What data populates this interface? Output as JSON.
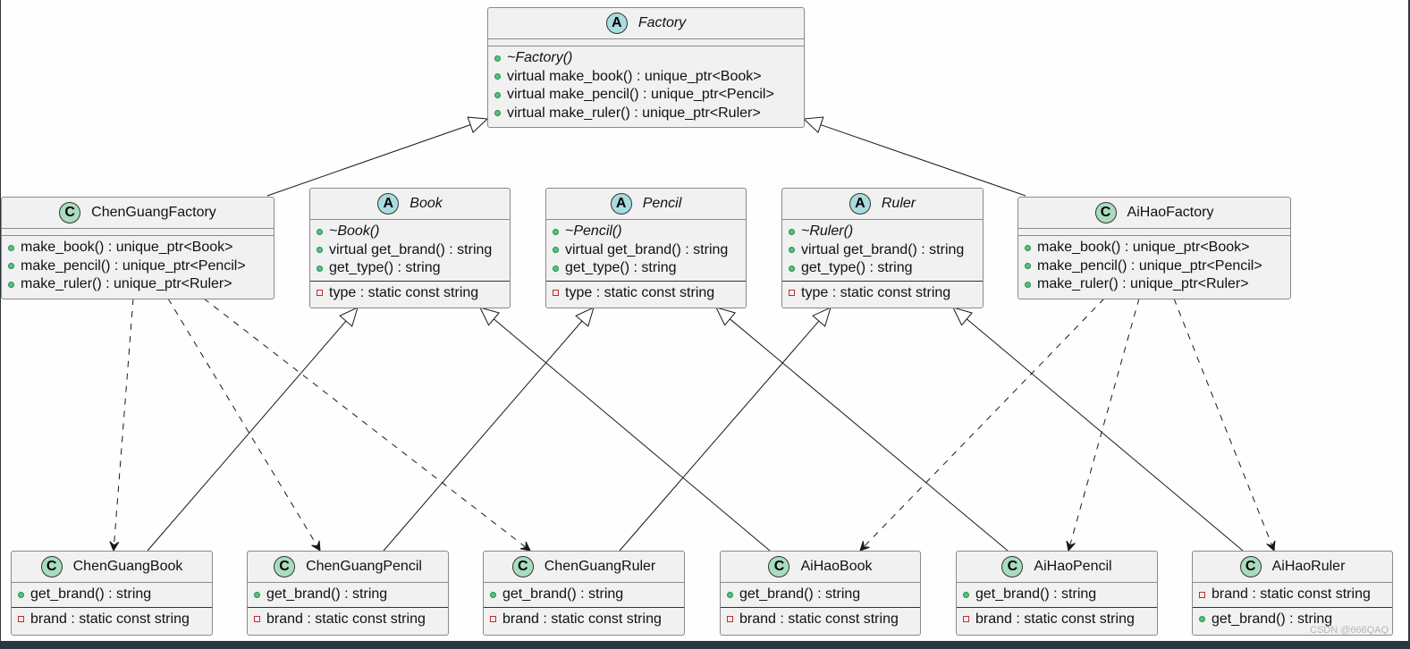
{
  "classes": [
    {
      "id": "Factory",
      "name": "Factory",
      "stereotype": "A",
      "sections": [
        [],
        [
          {
            "vis": "public",
            "text": "~Factory()",
            "italic": true
          },
          {
            "vis": "public",
            "text": "virtual make_book() : unique_ptr<Book>"
          },
          {
            "vis": "public",
            "text": "virtual make_pencil() : unique_ptr<Pencil>"
          },
          {
            "vis": "public",
            "text": "virtual make_ruler() : unique_ptr<Ruler>"
          }
        ]
      ]
    },
    {
      "id": "ChenGuangFactory",
      "name": "ChenGuangFactory",
      "stereotype": "C",
      "sections": [
        [],
        [
          {
            "vis": "public",
            "text": "make_book() : unique_ptr<Book>"
          },
          {
            "vis": "public",
            "text": "make_pencil() : unique_ptr<Pencil>"
          },
          {
            "vis": "public",
            "text": "make_ruler() : unique_ptr<Ruler>"
          }
        ]
      ]
    },
    {
      "id": "Book",
      "name": "Book",
      "stereotype": "A",
      "sections": [
        [
          {
            "vis": "public",
            "text": "~Book()",
            "italic": true
          },
          {
            "vis": "public",
            "text": "virtual get_brand() : string"
          },
          {
            "vis": "public",
            "text": "get_type() : string"
          }
        ],
        [
          {
            "vis": "private",
            "text": "type : static const string"
          }
        ]
      ]
    },
    {
      "id": "Pencil",
      "name": "Pencil",
      "stereotype": "A",
      "sections": [
        [
          {
            "vis": "public",
            "text": "~Pencil()",
            "italic": true
          },
          {
            "vis": "public",
            "text": "virtual get_brand() : string"
          },
          {
            "vis": "public",
            "text": "get_type() : string"
          }
        ],
        [
          {
            "vis": "private",
            "text": "type : static const string"
          }
        ]
      ]
    },
    {
      "id": "Ruler",
      "name": "Ruler",
      "stereotype": "A",
      "sections": [
        [
          {
            "vis": "public",
            "text": "~Ruler()",
            "italic": true
          },
          {
            "vis": "public",
            "text": "virtual get_brand() : string"
          },
          {
            "vis": "public",
            "text": "get_type() : string"
          }
        ],
        [
          {
            "vis": "private",
            "text": "type : static const string"
          }
        ]
      ]
    },
    {
      "id": "AiHaoFactory",
      "name": "AiHaoFactory",
      "stereotype": "C",
      "sections": [
        [],
        [
          {
            "vis": "public",
            "text": "make_book() : unique_ptr<Book>"
          },
          {
            "vis": "public",
            "text": "make_pencil() : unique_ptr<Pencil>"
          },
          {
            "vis": "public",
            "text": "make_ruler() : unique_ptr<Ruler>"
          }
        ]
      ]
    },
    {
      "id": "ChenGuangBook",
      "name": "ChenGuangBook",
      "stereotype": "C",
      "sections": [
        [
          {
            "vis": "public",
            "text": "get_brand() : string"
          }
        ],
        [
          {
            "vis": "private",
            "text": "brand : static const string"
          }
        ]
      ]
    },
    {
      "id": "ChenGuangPencil",
      "name": "ChenGuangPencil",
      "stereotype": "C",
      "sections": [
        [
          {
            "vis": "public",
            "text": "get_brand() : string"
          }
        ],
        [
          {
            "vis": "private",
            "text": "brand : static const string"
          }
        ]
      ]
    },
    {
      "id": "ChenGuangRuler",
      "name": "ChenGuangRuler",
      "stereotype": "C",
      "sections": [
        [
          {
            "vis": "public",
            "text": "get_brand() : string"
          }
        ],
        [
          {
            "vis": "private",
            "text": "brand : static const string"
          }
        ]
      ]
    },
    {
      "id": "AiHaoBook",
      "name": "AiHaoBook",
      "stereotype": "C",
      "sections": [
        [
          {
            "vis": "public",
            "text": "get_brand() : string"
          }
        ],
        [
          {
            "vis": "private",
            "text": "brand : static const string"
          }
        ]
      ]
    },
    {
      "id": "AiHaoPencil",
      "name": "AiHaoPencil",
      "stereotype": "C",
      "sections": [
        [
          {
            "vis": "public",
            "text": "get_brand() : string"
          }
        ],
        [
          {
            "vis": "private",
            "text": "brand : static const string"
          }
        ]
      ]
    },
    {
      "id": "AiHaoRuler",
      "name": "AiHaoRuler",
      "stereotype": "C",
      "sections": [
        [
          {
            "vis": "private",
            "text": "brand : static const string"
          }
        ],
        [
          {
            "vis": "public",
            "text": "get_brand() : string"
          }
        ]
      ]
    }
  ],
  "relations": [
    {
      "from": "ChenGuangFactory",
      "to": "Factory",
      "kind": "inheritance"
    },
    {
      "from": "AiHaoFactory",
      "to": "Factory",
      "kind": "inheritance"
    },
    {
      "from": "ChenGuangFactory",
      "to": "ChenGuangBook",
      "kind": "dependency"
    },
    {
      "from": "ChenGuangFactory",
      "to": "ChenGuangPencil",
      "kind": "dependency"
    },
    {
      "from": "ChenGuangFactory",
      "to": "ChenGuangRuler",
      "kind": "dependency"
    },
    {
      "from": "AiHaoFactory",
      "to": "AiHaoBook",
      "kind": "dependency"
    },
    {
      "from": "AiHaoFactory",
      "to": "AiHaoPencil",
      "kind": "dependency"
    },
    {
      "from": "AiHaoFactory",
      "to": "AiHaoRuler",
      "kind": "dependency"
    },
    {
      "from": "ChenGuangBook",
      "to": "Book",
      "kind": "inheritance"
    },
    {
      "from": "ChenGuangPencil",
      "to": "Pencil",
      "kind": "inheritance"
    },
    {
      "from": "ChenGuangRuler",
      "to": "Ruler",
      "kind": "inheritance"
    },
    {
      "from": "AiHaoBook",
      "to": "Book",
      "kind": "inheritance"
    },
    {
      "from": "AiHaoPencil",
      "to": "Pencil",
      "kind": "inheritance"
    },
    {
      "from": "AiHaoRuler",
      "to": "Ruler",
      "kind": "inheritance"
    }
  ],
  "watermark": "CSDN @666QAQ"
}
